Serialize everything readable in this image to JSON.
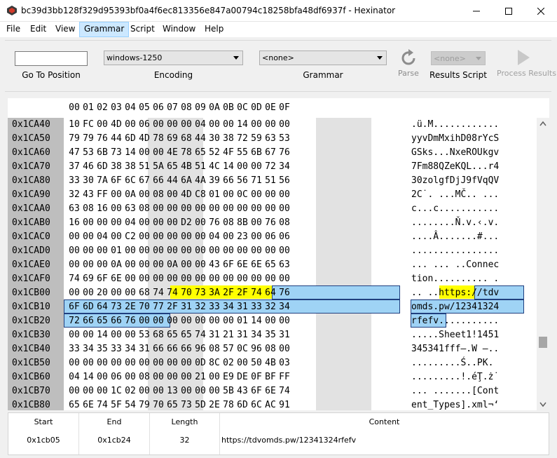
{
  "window": {
    "title": "bc39d3bb128f329d95393bf0a4f6ec813356e847a00794c18258bfa48df6937f - Hexinator"
  },
  "menu": [
    "File",
    "Edit",
    "View",
    "Grammar",
    "Script",
    "Window",
    "Help"
  ],
  "toolbar": {
    "goto_label": "Go To Position",
    "goto_value": "",
    "encoding_value": "windows-1250",
    "encoding_label": "Encoding",
    "grammar_value": "<none>",
    "grammar_label": "Grammar",
    "parse_label": "Parse",
    "results_script_value": "<none>",
    "results_script_label": "Results Script",
    "process_results_label": "Process Results"
  },
  "hex": {
    "columns": [
      "00",
      "01",
      "02",
      "03",
      "04",
      "05",
      "06",
      "07",
      "08",
      "09",
      "0A",
      "0B",
      "0C",
      "0D",
      "0E",
      "0F"
    ],
    "rows": [
      {
        "addr": "0x1CA40",
        "bytes": [
          "10",
          "FC",
          "00",
          "4D",
          "00",
          "06",
          "00",
          "00",
          "00",
          "04",
          "00",
          "00",
          "14",
          "00",
          "00",
          "00"
        ],
        "ascii": ".ü.M............"
      },
      {
        "addr": "0x1CA50",
        "bytes": [
          "79",
          "79",
          "76",
          "44",
          "6D",
          "4D",
          "78",
          "69",
          "68",
          "44",
          "30",
          "38",
          "72",
          "59",
          "63",
          "53"
        ],
        "ascii": "yyvDmMxihD08rYcS"
      },
      {
        "addr": "0x1CA60",
        "bytes": [
          "47",
          "53",
          "6B",
          "73",
          "14",
          "00",
          "00",
          "4E",
          "78",
          "65",
          "52",
          "4F",
          "55",
          "6B",
          "67",
          "76"
        ],
        "ascii": "GSks...NxeROUkgv"
      },
      {
        "addr": "0x1CA70",
        "bytes": [
          "37",
          "46",
          "6D",
          "38",
          "38",
          "51",
          "5A",
          "65",
          "4B",
          "51",
          "4C",
          "14",
          "00",
          "00",
          "72",
          "34"
        ],
        "ascii": "7Fm88QZeKQL...r4"
      },
      {
        "addr": "0x1CA80",
        "bytes": [
          "33",
          "30",
          "7A",
          "6F",
          "6C",
          "67",
          "66",
          "44",
          "6A",
          "4A",
          "39",
          "66",
          "56",
          "71",
          "51",
          "56"
        ],
        "ascii": "30zolgfDjJ9fVqQV"
      },
      {
        "addr": "0x1CA90",
        "bytes": [
          "32",
          "43",
          "FF",
          "00",
          "0A",
          "00",
          "08",
          "00",
          "4D",
          "C8",
          "01",
          "00",
          "0C",
          "00",
          "00",
          "00"
        ],
        "ascii": "2C˙. ...MČ.. ..."
      },
      {
        "addr": "0x1CAA0",
        "bytes": [
          "63",
          "08",
          "16",
          "00",
          "63",
          "08",
          "00",
          "00",
          "00",
          "00",
          "00",
          "00",
          "00",
          "00",
          "00",
          "00"
        ],
        "ascii": "c...c..........."
      },
      {
        "addr": "0x1CAB0",
        "bytes": [
          "16",
          "00",
          "00",
          "00",
          "04",
          "00",
          "00",
          "00",
          "D2",
          "00",
          "76",
          "08",
          "8B",
          "00",
          "76",
          "08"
        ],
        "ascii": "........Ň.v.‹.v."
      },
      {
        "addr": "0x1CAC0",
        "bytes": [
          "00",
          "00",
          "04",
          "00",
          "C2",
          "00",
          "00",
          "00",
          "00",
          "00",
          "04",
          "00",
          "23",
          "00",
          "06",
          "06"
        ],
        "ascii": "....Â.......#..."
      },
      {
        "addr": "0x1CAD0",
        "bytes": [
          "00",
          "00",
          "00",
          "01",
          "00",
          "00",
          "00",
          "00",
          "00",
          "00",
          "00",
          "00",
          "00",
          "00",
          "00",
          "00"
        ],
        "ascii": "................"
      },
      {
        "addr": "0x1CAE0",
        "bytes": [
          "00",
          "00",
          "00",
          "0A",
          "00",
          "00",
          "00",
          "0A",
          "00",
          "00",
          "43",
          "6F",
          "6E",
          "6E",
          "65",
          "63"
        ],
        "ascii": "... ... ..Connec"
      },
      {
        "addr": "0x1CAF0",
        "bytes": [
          "74",
          "69",
          "6F",
          "6E",
          "00",
          "00",
          "00",
          "00",
          "00",
          "00",
          "00",
          "00",
          "00",
          "00",
          "00",
          "00"
        ],
        "ascii": "tion.......... ."
      },
      {
        "addr": "0x1CB00",
        "bytes": [
          "00",
          "00",
          "20",
          "00",
          "00",
          "68",
          "74",
          "74",
          "70",
          "73",
          "3A",
          "2F",
          "2F",
          "74",
          "64",
          "76"
        ],
        "ascii": ".. ..https://tdv"
      },
      {
        "addr": "0x1CB10",
        "bytes": [
          "6F",
          "6D",
          "64",
          "73",
          "2E",
          "70",
          "77",
          "2F",
          "31",
          "32",
          "33",
          "34",
          "31",
          "33",
          "32",
          "34"
        ],
        "ascii": "omds.pw/12341324"
      },
      {
        "addr": "0x1CB20",
        "bytes": [
          "72",
          "66",
          "65",
          "66",
          "76",
          "00",
          "00",
          "00",
          "00",
          "00",
          "00",
          "00",
          "01",
          "14",
          "00",
          "00"
        ],
        "ascii": "rfefv..........."
      },
      {
        "addr": "0x1CB30",
        "bytes": [
          "00",
          "00",
          "14",
          "00",
          "00",
          "53",
          "68",
          "65",
          "65",
          "74",
          "31",
          "21",
          "31",
          "34",
          "35",
          "31"
        ],
        "ascii": ".....Sheet1!1451"
      },
      {
        "addr": "0x1CB40",
        "bytes": [
          "33",
          "34",
          "35",
          "33",
          "34",
          "31",
          "66",
          "66",
          "66",
          "96",
          "08",
          "57",
          "0C",
          "96",
          "08",
          "00"
        ],
        "ascii": "345341fff–.W –.."
      },
      {
        "addr": "0x1CB50",
        "bytes": [
          "00",
          "00",
          "00",
          "00",
          "00",
          "00",
          "00",
          "00",
          "00",
          "0D",
          "8C",
          "02",
          "00",
          "50",
          "4B",
          "03"
        ],
        "ascii": ".........Ś..PK."
      },
      {
        "addr": "0x1CB60",
        "bytes": [
          "04",
          "14",
          "00",
          "06",
          "00",
          "08",
          "00",
          "00",
          "00",
          "21",
          "00",
          "E9",
          "DE",
          "0F",
          "BF",
          "FF"
        ],
        "ascii": ".........!.éŢ.ż˙"
      },
      {
        "addr": "0x1CB70",
        "bytes": [
          "00",
          "00",
          "00",
          "1C",
          "02",
          "00",
          "00",
          "13",
          "00",
          "00",
          "00",
          "5B",
          "43",
          "6F",
          "6E",
          "74"
        ],
        "ascii": "... .......[Cont"
      },
      {
        "addr": "0x1CB80",
        "bytes": [
          "65",
          "6E",
          "74",
          "5F",
          "54",
          "79",
          "70",
          "65",
          "73",
          "5D",
          "2E",
          "78",
          "6D",
          "6C",
          "AC",
          "91"
        ],
        "ascii": "ent_Types].xml¬‘"
      }
    ]
  },
  "results": {
    "headers": [
      "Start",
      "End",
      "Length",
      "Content"
    ],
    "values": [
      "0x1cb05",
      "0x1cb24",
      "32",
      "https://tdvomds.pw/12341324rfefv"
    ]
  }
}
